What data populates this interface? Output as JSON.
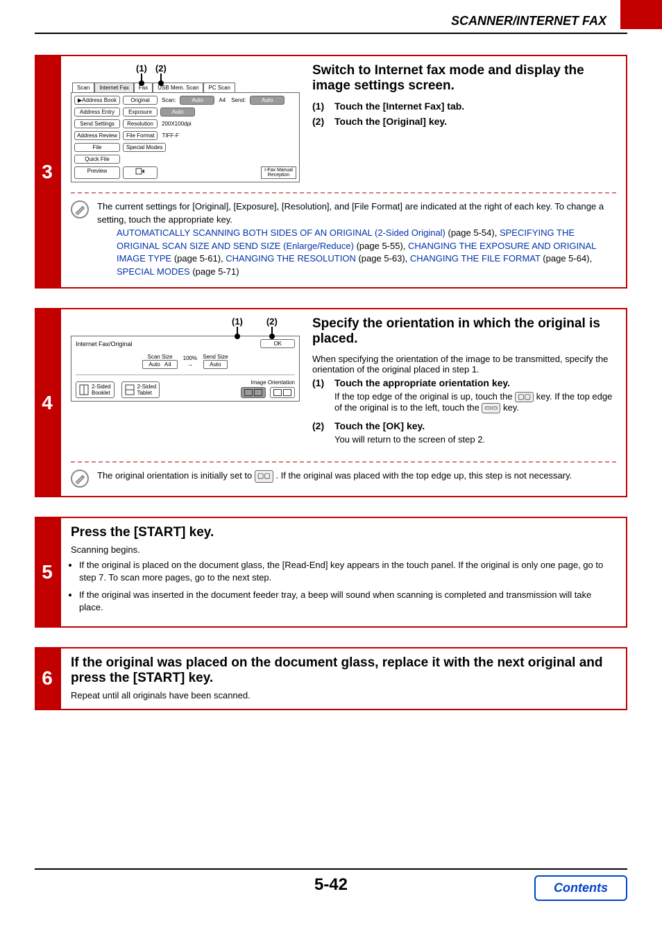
{
  "header": {
    "section": "SCANNER/INTERNET FAX"
  },
  "step3": {
    "num": "3",
    "title": "Switch to Internet fax mode and display the image settings screen.",
    "items": [
      {
        "n": "(1)",
        "text": "Touch the [Internet Fax] tab."
      },
      {
        "n": "(2)",
        "text": "Touch the [Original] key."
      }
    ],
    "callouts": {
      "c1": "(1)",
      "c2": "(2)"
    },
    "ui": {
      "tabs": {
        "scan": "Scan",
        "ifax": "Internet Fax",
        "fax": "Fax",
        "usb": "USB Mem. Scan",
        "pc": "PC Scan"
      },
      "side": {
        "address_book": "Address Book",
        "address_entry": "Address Entry",
        "send_settings": "Send Settings",
        "address_review": "Address Review",
        "file": "File",
        "quick_file": "Quick File",
        "preview": "Preview"
      },
      "rows": {
        "original": "Original",
        "scan": "Scan:",
        "auto": "Auto",
        "a4": "A4",
        "send": "Send:",
        "exposure": "Exposure",
        "resolution": "Resolution",
        "res_val": "200X100dpi",
        "file_format": "File Format",
        "ff_val": "TIFF-F",
        "special": "Special Modes"
      },
      "manual": "I-Fax Manual\nReception"
    },
    "note_lead": "The current settings for [Original], [Exposure], [Resolution], and [File Format] are indicated at the right of each key. To change a setting, touch the appropriate key.",
    "links": {
      "l1": "AUTOMATICALLY SCANNING BOTH SIDES OF AN ORIGINAL (2-Sided Original)",
      "l1p": " (page 5-54), ",
      "l2": "SPECIFYING THE ORIGINAL SCAN SIZE AND SEND SIZE (Enlarge/Reduce)",
      "l2p": " (page 5-55), ",
      "l3": "CHANGING THE EXPOSURE AND ORIGINAL IMAGE TYPE",
      "l3p": " (page 5-61), ",
      "l4": "CHANGING THE RESOLUTION",
      "l4p": " (page 5-63), ",
      "l5": "CHANGING THE FILE FORMAT",
      "l5p": " (page 5-64), ",
      "l6": "SPECIAL MODES",
      "l6p": " (page 5-71)"
    }
  },
  "step4": {
    "num": "4",
    "title": "Specify the orientation in which the original is placed.",
    "lead": "When specifying the orientation of the image to be transmitted, specify the orientation of the original placed in step 1.",
    "items": [
      {
        "n": "(1)",
        "text": "Touch the appropriate orientation key.",
        "sub_a": "If the top edge of the original is up, touch the ",
        "sub_b": " key. If the top edge of the original is to the left, touch the ",
        "sub_c": " key."
      },
      {
        "n": "(2)",
        "text": "Touch the [OK] key.",
        "sub": "You will return to the screen of step 2."
      }
    ],
    "callouts": {
      "c1": "(1)",
      "c2": "(2)"
    },
    "ui": {
      "title": "Internet Fax/Original",
      "ok": "OK",
      "scan_size": "Scan Size",
      "pct": "100%",
      "send_size": "Send Size",
      "auto": "Auto",
      "a4": "A4",
      "orient": "Image Orientation",
      "booklet": "2-Sided\nBooklet",
      "tablet": "2-Sided\nTablet"
    },
    "note_a": "The original orientation is initially set to ",
    "note_b": " . If the original was placed with the top edge up, this step is not necessary."
  },
  "step5": {
    "num": "5",
    "title": "Press the [START] key.",
    "lead": "Scanning begins.",
    "b1": "If the original is placed on the document glass, the [Read-End] key appears in the touch panel. If the original is only one page, go to step 7. To scan more pages, go to the next step.",
    "b2": "If the original was inserted in the document feeder tray, a beep will sound when scanning is completed and transmission will take place."
  },
  "step6": {
    "num": "6",
    "title": "If the original was placed on the document glass, replace it with the next original and press the [START] key.",
    "lead": "Repeat until all originals have been scanned."
  },
  "footer": {
    "page": "5-42",
    "contents": "Contents"
  },
  "chart_data": {
    "type": "table",
    "title": "Instruction steps on page 5-42",
    "rows": [
      {
        "step": 3,
        "action": "Switch to Internet fax mode and display the image settings screen."
      },
      {
        "step": 4,
        "action": "Specify the orientation in which the original is placed."
      },
      {
        "step": 5,
        "action": "Press the [START] key."
      },
      {
        "step": 6,
        "action": "If the original was placed on the document glass, replace it with the next original and press the [START] key."
      }
    ]
  }
}
